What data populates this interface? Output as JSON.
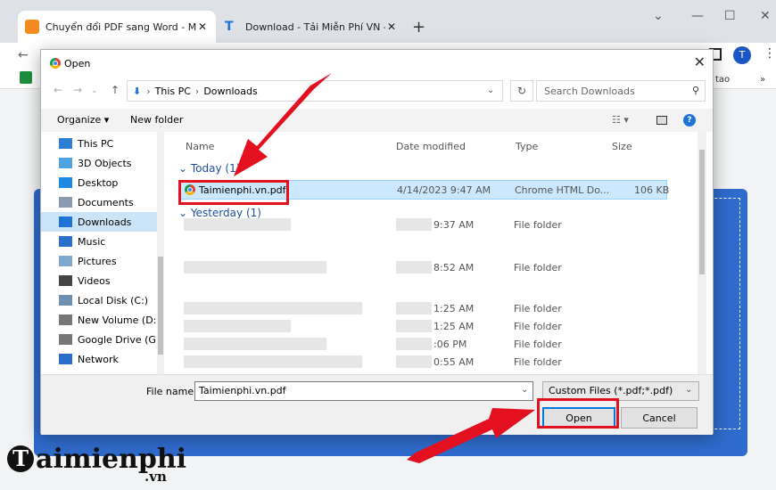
{
  "browser": {
    "tabs": [
      {
        "title": "Chuyển đổi PDF sang Word - Mi",
        "close": "✕"
      },
      {
        "title": "Download - Tải Miễn Phí VN - Ph",
        "close": "✕"
      }
    ],
    "new_tab": "+",
    "right_text": "tao"
  },
  "dialog": {
    "title": "Open",
    "close": "✕",
    "breadcrumb": [
      "This PC",
      "Downloads"
    ],
    "search_placeholder": "Search Downloads",
    "commands": {
      "organize": "Organize ▾",
      "new_folder": "New folder"
    },
    "nav_items": [
      {
        "label": "This PC",
        "icon": "pc-icon",
        "color": "#2d7fd3"
      },
      {
        "label": "3D Objects",
        "icon": "cube-icon",
        "color": "#4fa3e0"
      },
      {
        "label": "Desktop",
        "icon": "desktop-icon",
        "color": "#1e88e5"
      },
      {
        "label": "Documents",
        "icon": "document-icon",
        "color": "#8a9bb0"
      },
      {
        "label": "Downloads",
        "icon": "download-icon",
        "color": "#1e73d6"
      },
      {
        "label": "Music",
        "icon": "music-icon",
        "color": "#2a6fc9"
      },
      {
        "label": "Pictures",
        "icon": "pictures-icon",
        "color": "#7fa8cc"
      },
      {
        "label": "Videos",
        "icon": "video-icon",
        "color": "#444"
      },
      {
        "label": "Local Disk (C:)",
        "icon": "disk-icon",
        "color": "#6d8fb0"
      },
      {
        "label": "New Volume (D:",
        "icon": "drive-icon",
        "color": "#777"
      },
      {
        "label": "Google Drive (G:",
        "icon": "drive-icon",
        "color": "#777"
      },
      {
        "label": "Network",
        "icon": "network-icon",
        "color": "#2a6fc9"
      }
    ],
    "columns": {
      "name": "Name",
      "date": "Date modified",
      "type": "Type",
      "size": "Size"
    },
    "groups": {
      "today": "Today (1)",
      "yesterday": "Yesterday (1)"
    },
    "selected_file": {
      "name": "Taimienphi.vn.pdf",
      "date": "4/14/2023 9:47 AM",
      "type": "Chrome HTML Do...",
      "size": "106 KB"
    },
    "other_rows": [
      {
        "time": "9:37 AM",
        "type": "File folder"
      },
      {
        "time": "8:52 AM",
        "type": "File folder"
      },
      {
        "time": "1:25 AM",
        "type": "File folder"
      },
      {
        "time": "1:25 AM",
        "type": "File folder"
      },
      {
        "time": ":06 PM",
        "type": "File folder"
      },
      {
        "time": "0:55 AM",
        "type": "File folder"
      }
    ],
    "filename_label": "File name:",
    "filename_value": "Taimienphi.vn.pdf",
    "filter_value": "Custom Files (*.pdf;*.pdf)",
    "open_label": "Open",
    "cancel_label": "Cancel"
  },
  "watermark": {
    "brand": "aimienphi",
    "initial": "T",
    "suffix": ".vn"
  },
  "colors": {
    "highlight": "#e3101f",
    "accent": "#0078d7",
    "card": "#2f6bcc"
  }
}
